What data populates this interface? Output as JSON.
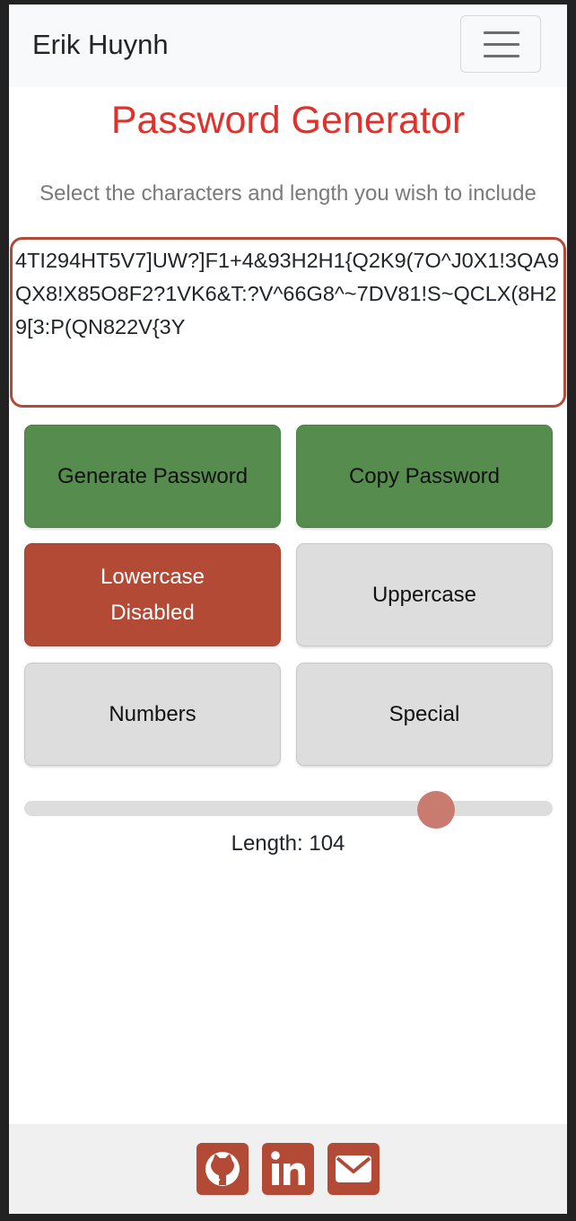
{
  "navbar": {
    "brand": "Erik Huynh",
    "menu_icon": "hamburger-menu-icon"
  },
  "header": {
    "title": "Password Generator",
    "subtitle": "Select the characters and length you wish to include"
  },
  "password": {
    "value": "4TI294HT5V7]UW?]F1+4&93H2H1{Q2K9(7O^J0X1!3QA9QX8!X85O8F2?1VK6&T:?V^66G8^~7DV81!S~QCLX(8H29[3:P(QN822V{3Y"
  },
  "buttons": {
    "generate": "Generate Password",
    "copy": "Copy Password",
    "lowercase_line1": "Lowercase",
    "lowercase_line2": "Disabled",
    "uppercase": "Uppercase",
    "numbers": "Numbers",
    "special": "Special"
  },
  "options": {
    "lowercase_enabled": false,
    "uppercase_enabled": true,
    "numbers_enabled": true,
    "special_enabled": true
  },
  "length": {
    "label": "Length:",
    "value": "104",
    "fraction": 0.78
  },
  "colors": {
    "accent_red": "#b34a36",
    "title_red": "#e0312a",
    "green": "#578c4f",
    "disabled_grey": "#dddddd"
  },
  "footer": {
    "icons": [
      "github-icon",
      "linkedin-icon",
      "email-icon"
    ]
  }
}
